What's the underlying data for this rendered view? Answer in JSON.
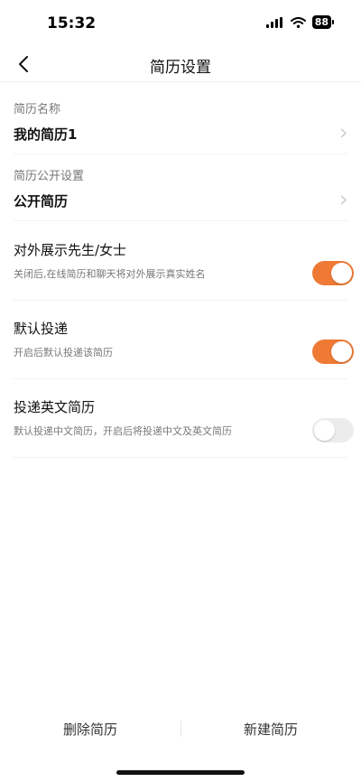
{
  "status_bar": {
    "time": "15:32",
    "battery": "88",
    "icons": [
      "signal-icon",
      "wifi-icon",
      "battery-icon"
    ]
  },
  "nav": {
    "title": "简历设置",
    "back_icon": "chevron-left-icon"
  },
  "settings": {
    "resume_name": {
      "label": "简历名称",
      "value": "我的简历1"
    },
    "public_setting": {
      "label": "简历公开设置",
      "value": "公开简历"
    },
    "toggles": [
      {
        "title": "对外展示先生/女士",
        "desc": "关闭后,在线简历和聊天将对外展示真实姓名",
        "on": true
      },
      {
        "title": "默认投递",
        "desc": "开启后默认投递该简历",
        "on": true
      },
      {
        "title": "投递英文简历",
        "desc": "默认投递中文简历，开启后将投递中文及英文简历",
        "on": false
      }
    ]
  },
  "bottom": {
    "delete_label": "删除简历",
    "new_label": "新建简历"
  },
  "colors": {
    "accent": "#ee7a35",
    "toggle_off": "#ececec"
  }
}
